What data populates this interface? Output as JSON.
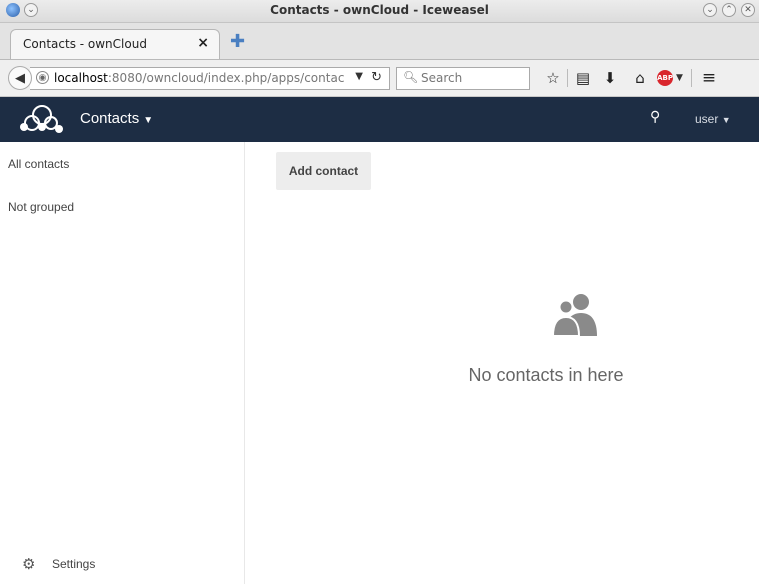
{
  "window": {
    "title": "Contacts - ownCloud - Iceweasel"
  },
  "tab": {
    "label": "Contacts - ownCloud",
    "close_glyph": "×",
    "new_tab_glyph": "✚"
  },
  "nav": {
    "url_host": "localhost",
    "url_rest": ":8080/owncloud/index.php/apps/contac",
    "search_placeholder": "Search"
  },
  "header": {
    "app_name": "Contacts",
    "user": "user"
  },
  "sidebar": {
    "items": [
      {
        "label": "All contacts"
      },
      {
        "label": "Not grouped"
      }
    ],
    "settings_label": "Settings"
  },
  "main": {
    "add_contact_label": "Add contact",
    "empty_message": "No contacts in here"
  },
  "colors": {
    "header_bg": "#1d2d44",
    "abp_red": "#d9262d"
  },
  "icons": [
    "app-icon",
    "minimize-icon",
    "maximize-icon",
    "close-icon",
    "back-icon",
    "globe-icon",
    "reload-icon",
    "search-icon",
    "bookmark-star-icon",
    "reading-list-icon",
    "download-icon",
    "home-icon",
    "adblock-icon",
    "menu-icon",
    "owncloud-logo",
    "gear-icon",
    "contacts-group-icon"
  ]
}
